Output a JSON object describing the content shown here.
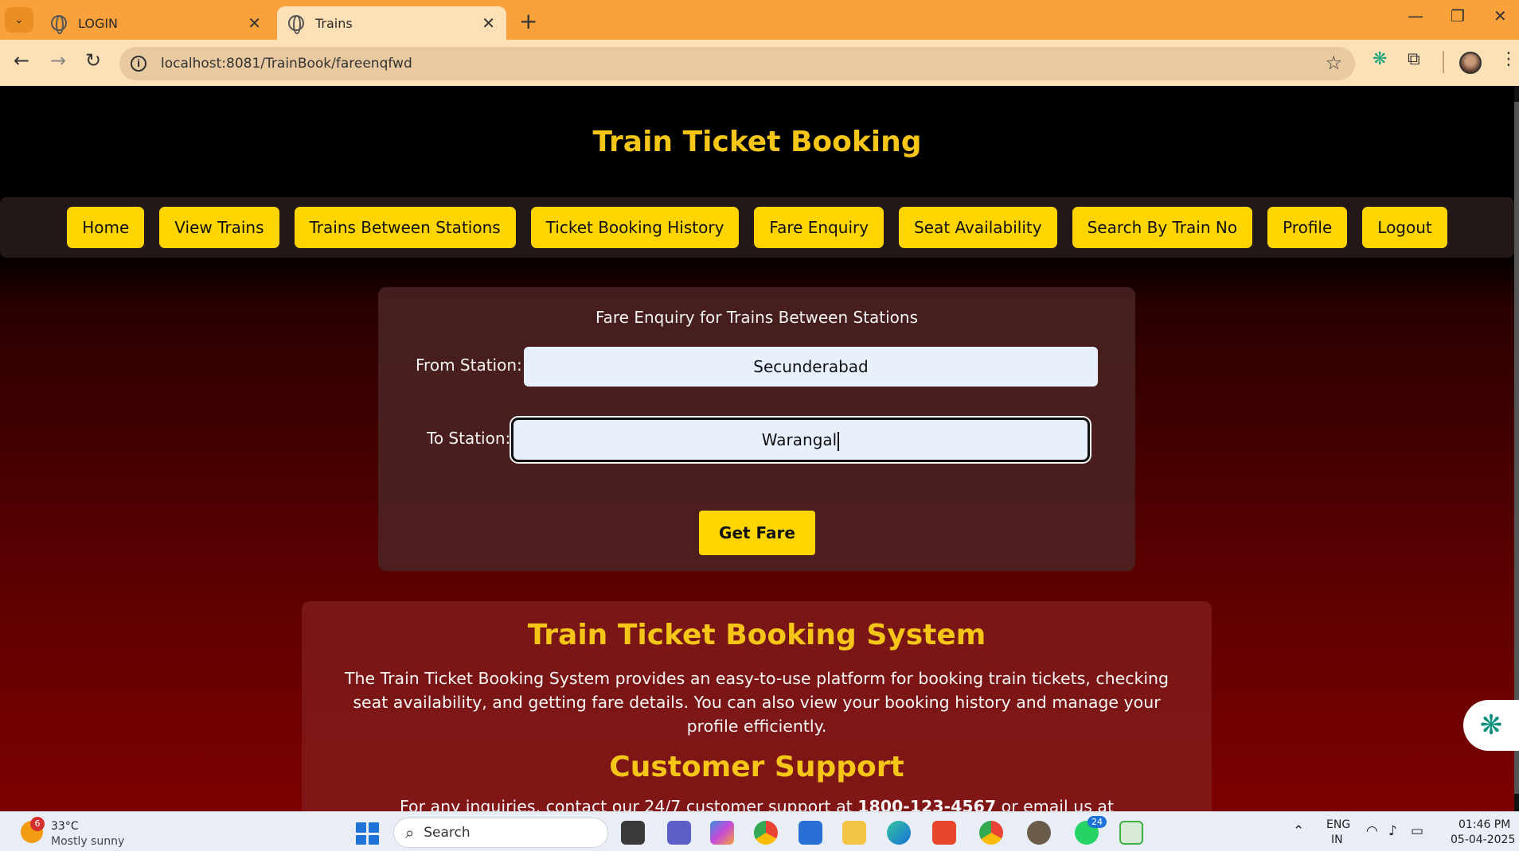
{
  "browser": {
    "tabs": [
      {
        "title": "LOGIN",
        "active": false
      },
      {
        "title": "Trains",
        "active": true
      }
    ],
    "url": "localhost:8081/TrainBook/fareenqfwd"
  },
  "site": {
    "title": "Train Ticket Booking",
    "nav": [
      "Home",
      "View Trains",
      "Trains Between Stations",
      "Ticket Booking History",
      "Fare Enquiry",
      "Seat Availability",
      "Search By Train No",
      "Profile",
      "Logout"
    ]
  },
  "fare_form": {
    "heading": "Fare Enquiry for Trains Between Stations",
    "from_label": "From Station:",
    "from_value": "Secunderabad",
    "to_label": "To Station:",
    "to_value": "Warangal",
    "submit_label": "Get Fare"
  },
  "info": {
    "system_heading": "Train Ticket Booking System",
    "system_text": "The Train Ticket Booking System provides an easy-to-use platform for booking train tickets, checking seat availability, and getting fare details. You can also view your booking history and manage your profile efficiently.",
    "support_heading": "Customer Support",
    "support_text_prefix": "For any inquiries, contact our 24/7 customer support at ",
    "support_phone": "1800-123-4567",
    "support_text_suffix": " or email us at"
  },
  "taskbar": {
    "weather_badge": "6",
    "weather_temp": "33°C",
    "weather_desc": "Mostly sunny",
    "search_placeholder": "Search",
    "whatsapp_badge": "24",
    "lang_top": "ENG",
    "lang_bottom": "IN",
    "time": "01:46 PM",
    "date": "05-04-2025"
  },
  "colors": {
    "accent": "#ffd500",
    "title": "#f5c518",
    "tabbar": "#f9a23c"
  }
}
